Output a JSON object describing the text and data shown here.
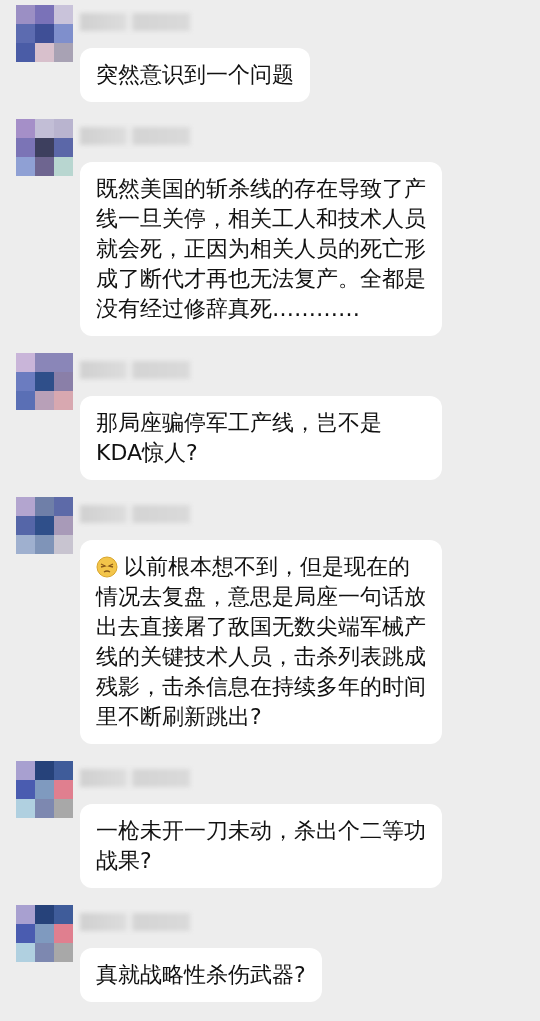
{
  "messages": [
    {
      "text": "突然意识到一个问题",
      "leading_emoji": false
    },
    {
      "text": "既然美国的斩杀线的存在导致了产线一旦关停，相关工人和技术人员就会死，正因为相关人员的死亡形成了断代才再也无法复产。全都是没有经过修辞真死…………",
      "leading_emoji": false
    },
    {
      "text": "那局座骗停军工产线，岂不是KDA惊人?",
      "leading_emoji": false
    },
    {
      "text": "以前根本想不到，但是现在的情况去复盘，意思是局座一句话放出去直接屠了敌国无数尖端军械产线的关键技术人员，击杀列表跳成残影，击杀信息在持续多年的时间里不断刷新跳出?",
      "leading_emoji": true
    },
    {
      "text": "一枪未开一刀未动，杀出个二等功战果?",
      "leading_emoji": false
    },
    {
      "text": "真就战略性杀伤武器?",
      "leading_emoji": false
    }
  ]
}
